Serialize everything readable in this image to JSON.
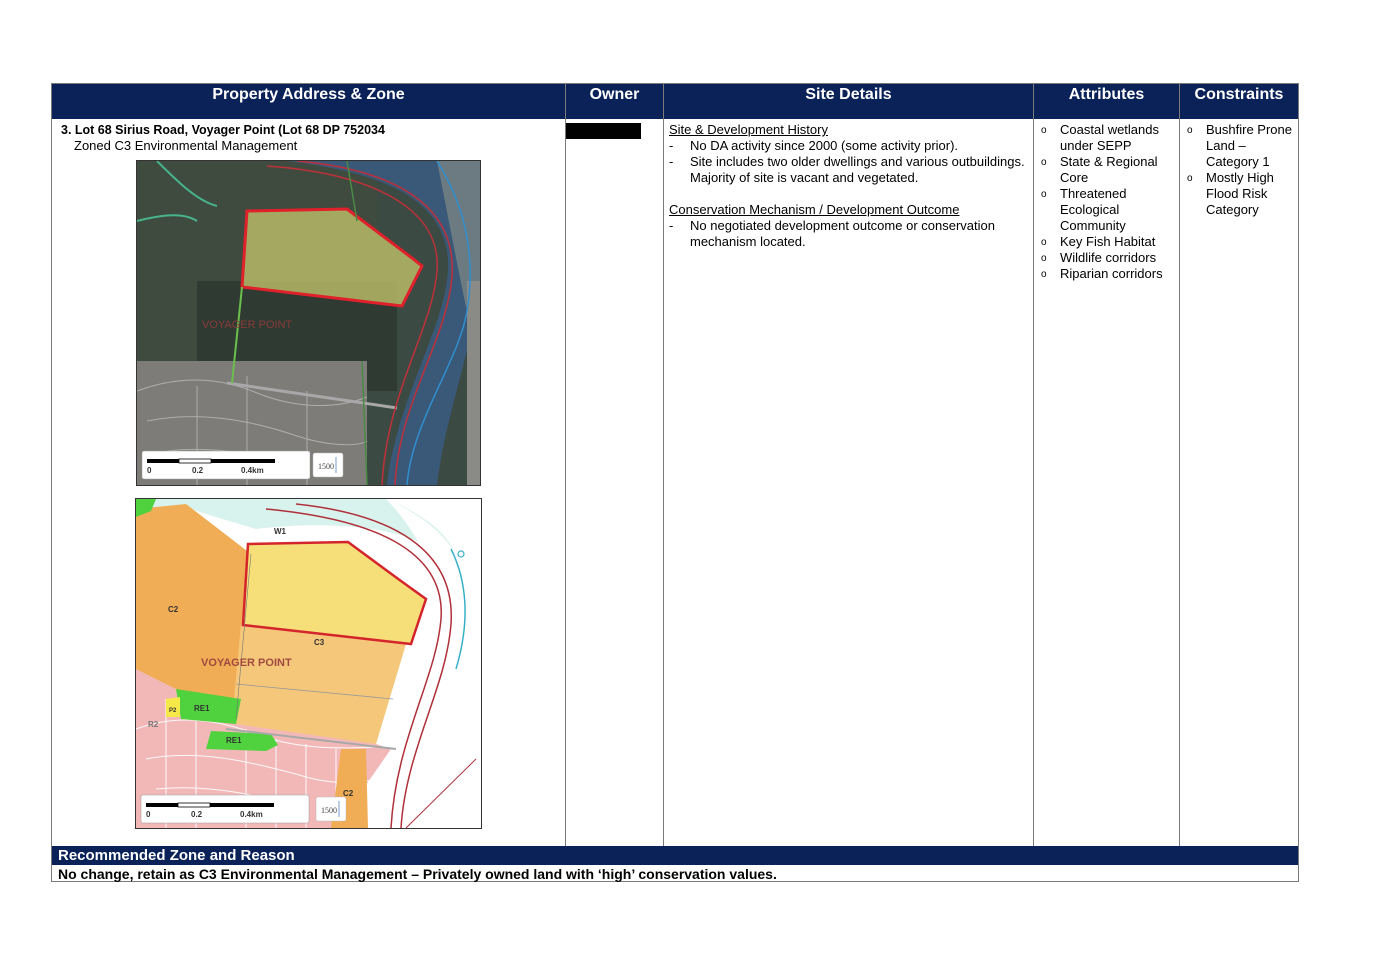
{
  "headers": {
    "property": "Property Address & Zone",
    "owner": "Owner",
    "site": "Site Details",
    "attributes": "Attributes",
    "constraints": "Constraints"
  },
  "property": {
    "address": "3. Lot 68 Sirius Road, Voyager Point (Lot 68 DP 752034",
    "zone": "Zoned C3 Environmental Management"
  },
  "site": {
    "history_heading": "Site & Development History",
    "history_items": [
      "No DA activity since 2000 (some activity prior).",
      "Site includes two older dwellings and various outbuildings. Majority of site is vacant and vegetated."
    ],
    "conservation_heading": "Conservation Mechanism / Development Outcome",
    "conservation_items": [
      "No negotiated development outcome or conservation mechanism located."
    ]
  },
  "attributes": [
    "Coastal wetlands under SEPP",
    "State & Regional Core",
    "Threatened Ecological Community",
    "Key Fish Habitat",
    "Wildlife corridors",
    "Riparian corridors"
  ],
  "constraints": [
    "Bushfire Prone Land – Category 1",
    "Mostly High Flood Risk Category"
  ],
  "map_aerial": {
    "scale_labels": [
      "0",
      "0.2",
      "0.4km"
    ],
    "scale_code": "1500",
    "place_label": "VOYAGER POINT"
  },
  "map_zoning": {
    "scale_labels": [
      "0",
      "0.2",
      "0.4km"
    ],
    "scale_code": "1500",
    "place_label": "VOYAGER POINT",
    "zone_labels": [
      "W1",
      "C2",
      "C3",
      "RE1",
      "RE1",
      "P2",
      "C2",
      "R2"
    ],
    "colors": {
      "c2": "#f0ad55",
      "c3": "#f5c77a",
      "subject": "#f6df78",
      "re1": "#4fd23e",
      "w1": "#d8f2ee",
      "r2": "#f2b8b8"
    }
  },
  "recommendation": {
    "heading": "Recommended Zone and Reason",
    "text": "No change, retain as C3 Environmental Management – Privately owned land with ‘high’ conservation values."
  }
}
